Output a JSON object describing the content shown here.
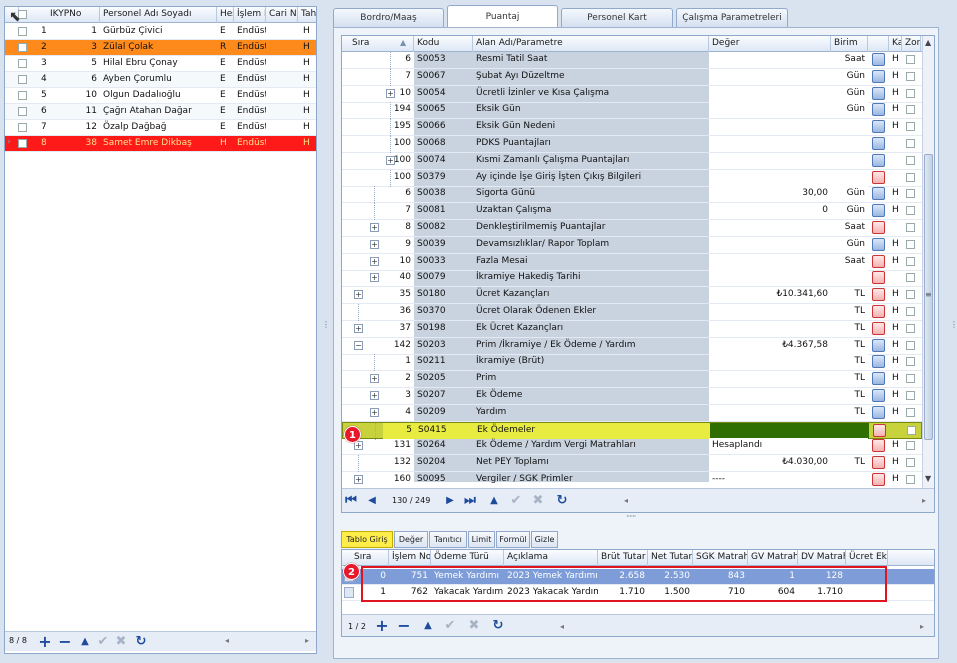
{
  "left_grid": {
    "headers": [
      "IKYPNo",
      "Personel Adı Soyadı",
      "Hes",
      "İşlem N",
      "Cari No",
      "Tah"
    ],
    "rows": [
      {
        "n": "1",
        "ikyp": "1",
        "name": "Gürbüz Çivici",
        "hes": "E",
        "islem": "Endüst",
        "tah": "H",
        "style": "normal"
      },
      {
        "n": "2",
        "ikyp": "3",
        "name": "Zülal Çolak",
        "hes": "R",
        "islem": "Endüst",
        "tah": "H",
        "style": "orange"
      },
      {
        "n": "3",
        "ikyp": "5",
        "name": "Hilal Ebru Çonay",
        "hes": "E",
        "islem": "Endüst",
        "tah": "H",
        "style": "normal"
      },
      {
        "n": "4",
        "ikyp": "6",
        "name": "Ayben Çorumlu",
        "hes": "E",
        "islem": "Endüst",
        "tah": "H",
        "style": "normal"
      },
      {
        "n": "5",
        "ikyp": "10",
        "name": "Olgun Dadalıoğlu",
        "hes": "E",
        "islem": "Endüst",
        "tah": "H",
        "style": "normal"
      },
      {
        "n": "6",
        "ikyp": "11",
        "name": "Çağrı Atahan Dağar",
        "hes": "E",
        "islem": "Endüst",
        "tah": "H",
        "style": "normal"
      },
      {
        "n": "7",
        "ikyp": "12",
        "name": "Özalp Dağbağ",
        "hes": "E",
        "islem": "Endüst",
        "tah": "H",
        "style": "normal"
      },
      {
        "n": "8",
        "ikyp": "38",
        "name": "Samet Emre Dikbaş",
        "hes": "H",
        "islem": "Endüst",
        "tah": "H",
        "style": "red"
      }
    ],
    "counter": "8 / 8"
  },
  "tabs": [
    "Bordro/Maaş",
    "Puantaj",
    "Personel Kart",
    "Çalışma Parametreleri"
  ],
  "main_grid": {
    "headers": [
      "Sıra",
      "Kodu",
      "Alan Adı/Parametre",
      "Değer",
      "Birim",
      "Ka",
      "Zor"
    ],
    "rows": [
      {
        "sira": "6",
        "kodu": "S0053",
        "alan": "Resmi Tatil Saat",
        "deger": "",
        "birim": "Saat",
        "h": "H",
        "indent": 2,
        "exp": "",
        "icon": "blue"
      },
      {
        "sira": "7",
        "kodu": "S0067",
        "alan": "Şubat Ayı Düzeltme",
        "deger": "",
        "birim": "Gün",
        "h": "H",
        "indent": 2,
        "exp": "",
        "icon": "blue"
      },
      {
        "sira": "10",
        "kodu": "S0054",
        "alan": "Ücretli İzinler ve Kısa Çalışma",
        "deger": "",
        "birim": "Gün",
        "h": "H",
        "indent": 2,
        "exp": "+",
        "icon": "blue"
      },
      {
        "sira": "194",
        "kodu": "S0065",
        "alan": "Eksik Gün",
        "deger": "",
        "birim": "Gün",
        "h": "H",
        "indent": 2,
        "exp": "",
        "icon": "blue"
      },
      {
        "sira": "195",
        "kodu": "S0066",
        "alan": "Eksik Gün Nedeni",
        "deger": "",
        "birim": "",
        "h": "H",
        "indent": 2,
        "exp": "",
        "icon": "blue"
      },
      {
        "sira": "100",
        "kodu": "S0068",
        "alan": "PDKS Puantajları",
        "deger": "",
        "birim": "",
        "h": "",
        "indent": 2,
        "exp": "",
        "icon": "gear"
      },
      {
        "sira": "100",
        "kodu": "S0074",
        "alan": "Kısmi Zamanlı Çalışma Puantajları",
        "deger": "",
        "birim": "",
        "h": "",
        "indent": 2,
        "exp": "+",
        "icon": "blue"
      },
      {
        "sira": "100",
        "kodu": "S0379",
        "alan": "Ay içinde İşe Giriş İşten Çıkış Bilgileri",
        "deger": "",
        "birim": "",
        "h": "",
        "indent": 2,
        "exp": "",
        "icon": "red"
      },
      {
        "sira": "6",
        "kodu": "S0038",
        "alan": "Sigorta Günü",
        "deger": "30,00",
        "birim": "Gün",
        "h": "H",
        "indent": 1,
        "exp": "",
        "icon": "blue"
      },
      {
        "sira": "7",
        "kodu": "S0081",
        "alan": "Uzaktan Çalışma",
        "deger": "0",
        "birim": "Gün",
        "h": "H",
        "indent": 1,
        "exp": "",
        "icon": "blue"
      },
      {
        "sira": "8",
        "kodu": "S0082",
        "alan": "Denkleştirilmemiş Puantajlar",
        "deger": "",
        "birim": "Saat",
        "h": "",
        "indent": 1,
        "exp": "+",
        "icon": "red"
      },
      {
        "sira": "9",
        "kodu": "S0039",
        "alan": "Devamsızlıklar/ Rapor Toplam",
        "deger": "",
        "birim": "Gün",
        "h": "H",
        "indent": 1,
        "exp": "+",
        "icon": "blue"
      },
      {
        "sira": "10",
        "kodu": "S0033",
        "alan": "Fazla Mesai",
        "deger": "",
        "birim": "Saat",
        "h": "H",
        "indent": 1,
        "exp": "+",
        "icon": "red"
      },
      {
        "sira": "40",
        "kodu": "S0079",
        "alan": "İkramiye Hakediş Tarihi",
        "deger": "",
        "birim": "",
        "h": "",
        "indent": 1,
        "exp": "+",
        "icon": "red"
      },
      {
        "sira": "35",
        "kodu": "S0180",
        "alan": "Ücret Kazançları",
        "deger": "₺10.341,60",
        "birim": "TL",
        "h": "H",
        "indent": 0,
        "exp": "+",
        "icon": "red"
      },
      {
        "sira": "36",
        "kodu": "S0370",
        "alan": "Ücret Olarak Ödenen Ekler",
        "deger": "",
        "birim": "TL",
        "h": "H",
        "indent": 0,
        "exp": "",
        "icon": "red"
      },
      {
        "sira": "37",
        "kodu": "S0198",
        "alan": "Ek Ücret Kazançları",
        "deger": "",
        "birim": "TL",
        "h": "H",
        "indent": 0,
        "exp": "+",
        "icon": "red"
      },
      {
        "sira": "142",
        "kodu": "S0203",
        "alan": "Prim /İkramiye / Ek Ödeme / Yardım",
        "deger": "₺4.367,58",
        "birim": "TL",
        "h": "H",
        "indent": 0,
        "exp": "−",
        "icon": "blue"
      },
      {
        "sira": "1",
        "kodu": "S0211",
        "alan": "İkramiye (Brüt)",
        "deger": "",
        "birim": "TL",
        "h": "H",
        "indent": 1,
        "exp": "",
        "icon": "blue"
      },
      {
        "sira": "2",
        "kodu": "S0205",
        "alan": "Prim",
        "deger": "",
        "birim": "TL",
        "h": "H",
        "indent": 1,
        "exp": "+",
        "icon": "blue"
      },
      {
        "sira": "3",
        "kodu": "S0207",
        "alan": "Ek Ödeme",
        "deger": "",
        "birim": "TL",
        "h": "H",
        "indent": 1,
        "exp": "+",
        "icon": "blue"
      },
      {
        "sira": "4",
        "kodu": "S0209",
        "alan": "Yardım",
        "deger": "",
        "birim": "TL",
        "h": "H",
        "indent": 1,
        "exp": "+",
        "icon": "blue"
      },
      {
        "sira": "5",
        "kodu": "S0415",
        "alan": "Ek Ödemeler",
        "deger": "",
        "birim": "",
        "h": "",
        "indent": 1,
        "exp": "",
        "icon": "red",
        "selected": true
      },
      {
        "sira": "131",
        "kodu": "S0264",
        "alan": "Ek Ödeme / Yardım Vergi Matrahları",
        "deger": "Hesaplandı",
        "birim": "",
        "h": "H",
        "indent": 0,
        "exp": "+",
        "icon": "red"
      },
      {
        "sira": "132",
        "kodu": "S0204",
        "alan": "Net PEY Toplamı",
        "deger": "₺4.030,00",
        "birim": "TL",
        "h": "H",
        "indent": 0,
        "exp": "",
        "icon": "red"
      },
      {
        "sira": "160",
        "kodu": "S0095",
        "alan": "Vergiler / SGK Primler",
        "deger": "----",
        "birim": "",
        "h": "H",
        "indent": 0,
        "exp": "+",
        "icon": "red"
      }
    ],
    "counter": "130 / 249"
  },
  "sub_tabs": [
    "Tablo Giriş",
    "Değer",
    "Tanıtıcı",
    "Limit",
    "Formül",
    "Gizle"
  ],
  "sub_grid": {
    "headers": [
      "Sıra",
      "İşlem No",
      "Ödeme Türü",
      "Açıklama",
      "Brüt Tutar",
      "Net Tutar",
      "SGK Matrah",
      "GV Matrah",
      "DV Matrah",
      "Ücret Ek"
    ],
    "rows": [
      {
        "sira": "0",
        "islem": "751",
        "tur": "Yemek Yardımı",
        "aciklama": "2023 Yemek Yardımı",
        "brut": "2.658",
        "net": "2.530",
        "sgk": "843",
        "gv": "1",
        "dv": "128"
      },
      {
        "sira": "1",
        "islem": "762",
        "tur": "Yakacak Yardımı",
        "aciklama": "2023 Yakacak Yardımı",
        "brut": "1.710",
        "net": "1.500",
        "sgk": "710",
        "gv": "604",
        "dv": "1.710"
      }
    ],
    "counter": "1 / 2"
  },
  "badges": [
    "1",
    "2"
  ],
  "nav_glyphs": {
    "first": "⏮",
    "prev": "◀",
    "next": "▶",
    "last": "⏭",
    "add": "+",
    "remove": "−",
    "up": "▲",
    "ok": "✔",
    "cancel": "✖",
    "refresh": "↻"
  },
  "colors": {
    "orange": "#ff8a1c",
    "red": "#ff1a1a",
    "selected": "#c8d23c",
    "accent": "#1e4c9c"
  }
}
